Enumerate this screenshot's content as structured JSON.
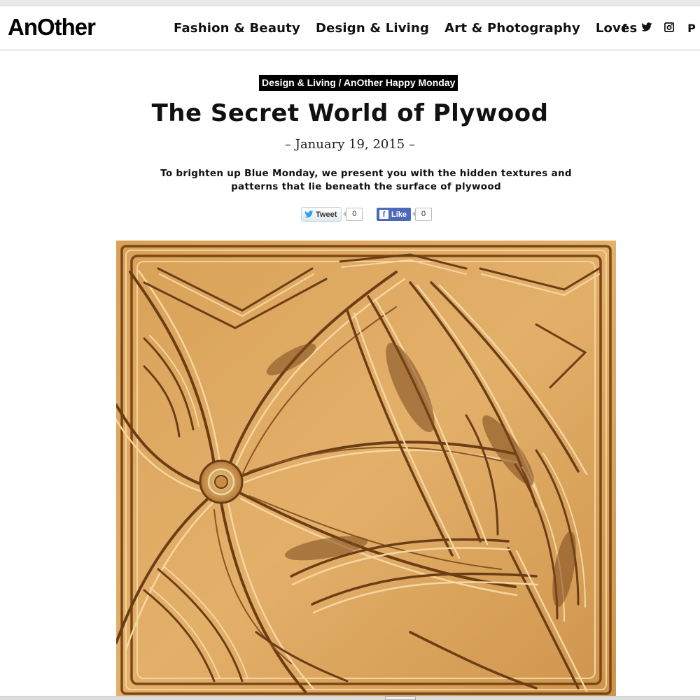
{
  "site": {
    "logo": "AnOther"
  },
  "nav": {
    "items": [
      "Fashion & Beauty",
      "Design & Living",
      "Art & Photography",
      "Loves"
    ],
    "social_icons": [
      "facebook-icon",
      "twitter-icon",
      "instagram-icon",
      "pinterest-icon"
    ]
  },
  "article": {
    "kicker": "Design & Living / AnOther Happy Monday",
    "title": "The Secret World of Plywood",
    "date": "– January 19, 2015 –",
    "standfirst": "To brighten up Blue Monday, we present you with the hidden textures and patterns that lie beneath the surface of plywood"
  },
  "share": {
    "tweet_label": "Tweet",
    "tweet_count": "0",
    "like_label": "Like",
    "like_count": "0"
  },
  "colors": {
    "facebook_blue": "#4c69ba",
    "wood_light": "#e3b06a",
    "wood_dark": "#6b3d16"
  }
}
